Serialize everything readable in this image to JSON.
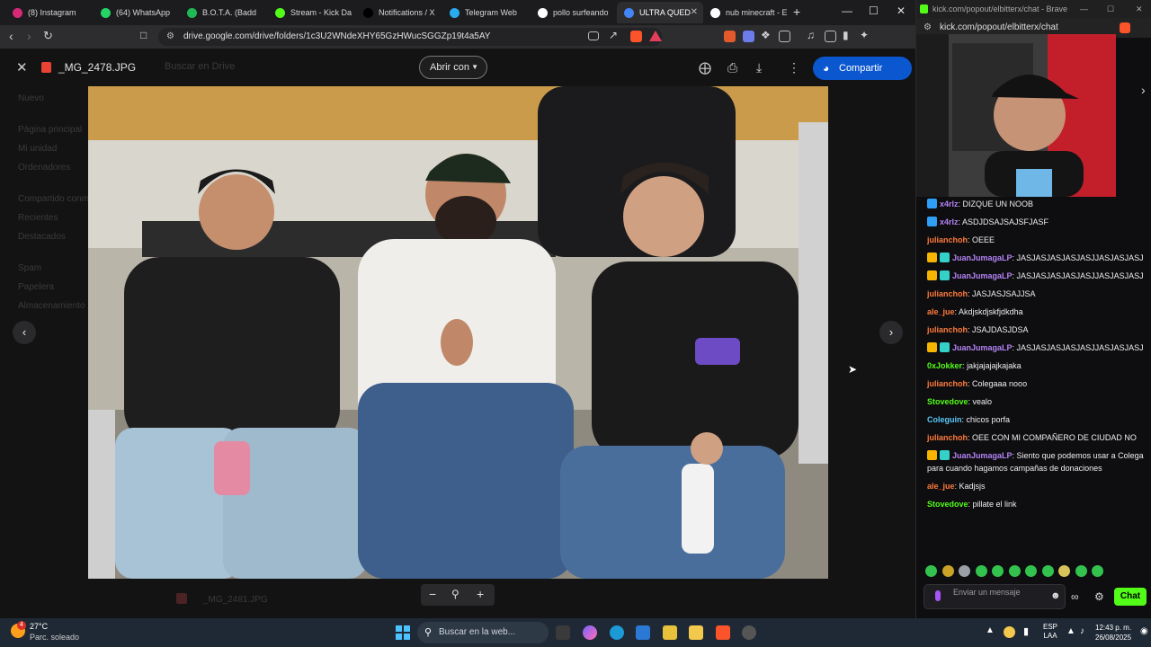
{
  "browser": {
    "tabs": [
      {
        "label": "(8) Instagram",
        "color": "#d62976"
      },
      {
        "label": "(64) WhatsApp",
        "color": "#25d366"
      },
      {
        "label": "B.O.T.A. (Badd",
        "color": "#1db954"
      },
      {
        "label": "Stream - Kick Da",
        "color": "#53fc18"
      },
      {
        "label": "Notifications / X",
        "color": "#000000"
      },
      {
        "label": "Telegram Web",
        "color": "#2aabee"
      },
      {
        "label": "pollo surfeando",
        "color": "#ffffff"
      },
      {
        "label": "ULTRA QUED",
        "color": "#4285f4"
      },
      {
        "label": "nub minecraft - E",
        "color": "#ffffff"
      }
    ],
    "url": "drive.google.com/drive/folders/1c3U2WNdeXHY65GzHWucSGGZp19t4a5AY"
  },
  "viewer": {
    "file_name": "_MG_2478.JPG",
    "open_with": "Abrir con",
    "share": "Compartir",
    "bg_search": "Buscar en Drive",
    "bg_nav": [
      "Nuevo",
      "Página principal",
      "Mi unidad",
      "Ordenadores",
      "Compartido conmigo",
      "Recientes",
      "Destacados",
      "Spam",
      "Papelera",
      "Almacenamiento"
    ],
    "bg_file": "_MG_2481.JPG"
  },
  "chat": {
    "window_title": "kick.com/popout/elbitterx/chat - Brave",
    "address": "kick.com/popout/elbitterx/chat",
    "messages": [
      {
        "user": "x4rlz",
        "text": "DIZQUE UN NOOB",
        "color": "#b483f5",
        "badge": "#2f9ef7"
      },
      {
        "user": "x4rlz",
        "text": "ASDJDSAJSAJSFJASF",
        "color": "#b483f5",
        "badge": "#2f9ef7"
      },
      {
        "user": "julianchoh",
        "text": "OEEE",
        "color": "#ff7a3c",
        "badge": ""
      },
      {
        "user": "JuanJumagaLP",
        "text": "JASJASJASJASJASJJASJASJASJ",
        "color": "#b483f5",
        "badge": "#f7b500"
      },
      {
        "user": "JuanJumagaLP",
        "text": "JASJASJASJASJASJJASJASJASJ",
        "color": "#b483f5",
        "badge": "#f7b500"
      },
      {
        "user": "julianchoh",
        "text": "JASJASJSAJJSA",
        "color": "#ff7a3c",
        "badge": ""
      },
      {
        "user": "ale_jue",
        "text": "Akdjskdjskfjdkdha",
        "color": "#ff7a3c",
        "badge": ""
      },
      {
        "user": "julianchoh",
        "text": "JSAJDASJDSA",
        "color": "#ff7a3c",
        "badge": ""
      },
      {
        "user": "JuanJumagaLP",
        "text": "JASJASJASJASJASJJASJASJASJ",
        "color": "#b483f5",
        "badge": "#f7b500"
      },
      {
        "user": "0xJokker",
        "text": "jakjajajajkajaka",
        "color": "#53fc18",
        "badge": ""
      },
      {
        "user": "julianchoh",
        "text": "Colegaaa nooo",
        "color": "#ff7a3c",
        "badge": ""
      },
      {
        "user": "Stovedove",
        "text": "vealo",
        "color": "#53fc18",
        "badge": ""
      },
      {
        "user": "Coleguin",
        "text": "chicos porfa",
        "color": "#5ac8fa",
        "badge": ""
      },
      {
        "user": "julianchoh",
        "text": "OEE CON MI COMPAÑERO DE CIUDAD NO",
        "color": "#ff7a3c",
        "badge": ""
      },
      {
        "user": "JuanJumagaLP",
        "text": "Siento que podemos usar a Colega para cuando hagamos campañas de donaciones",
        "color": "#b483f5",
        "badge": "#f7b500"
      },
      {
        "user": "ale_jue",
        "text": "Kadjsjs",
        "color": "#ff7a3c",
        "badge": ""
      },
      {
        "user": "Stovedove",
        "text": "pillate el link",
        "color": "#53fc18",
        "badge": ""
      }
    ],
    "input_placeholder": "Enviar un mensaje",
    "send_label": "Chat"
  },
  "taskbar": {
    "temperature": "27°C",
    "weather": "Parc. soleado",
    "search_placeholder": "Buscar en la web...",
    "lang": "ESP",
    "lang_sub": "LAA",
    "time": "12:43 p. m.",
    "date": "26/08/2025",
    "weather_badge": "4"
  }
}
